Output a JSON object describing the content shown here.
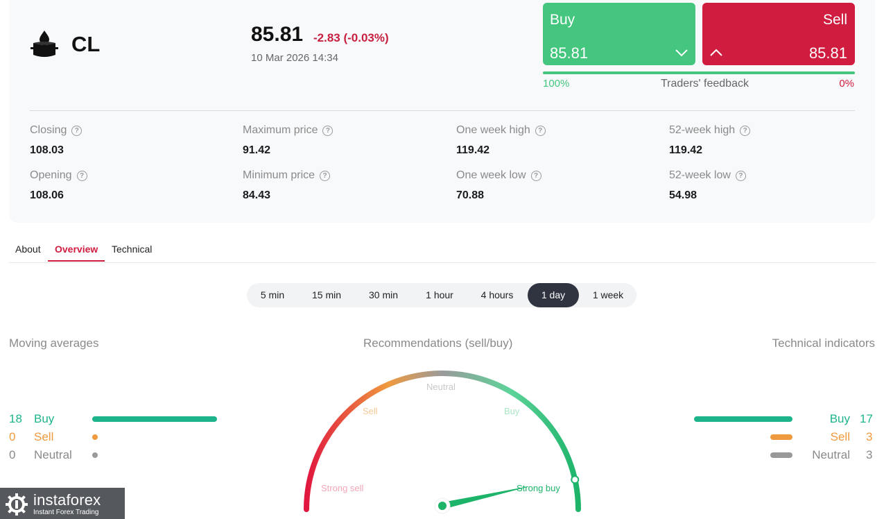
{
  "instrument": {
    "symbol": "CL",
    "icon": "oil-barrel-icon",
    "price": "85.81",
    "change": "-2.83 (-0.03%)",
    "datetime": "10 Mar 2026 14:34"
  },
  "trade": {
    "buy_label": "Buy",
    "buy_price": "85.81",
    "sell_label": "Sell",
    "sell_price": "85.81"
  },
  "feedback": {
    "buy_pct": "100%",
    "sell_pct": "0%",
    "label": "Traders' feedback",
    "buy_fraction": 1.0
  },
  "stats": [
    {
      "label": "Closing",
      "value": "108.03"
    },
    {
      "label": "Maximum price",
      "value": "91.42"
    },
    {
      "label": "One week high",
      "value": "119.42"
    },
    {
      "label": "52-week high",
      "value": "119.42"
    },
    {
      "label": "Opening",
      "value": "108.06"
    },
    {
      "label": "Minimum price",
      "value": "84.43"
    },
    {
      "label": "One week low",
      "value": "70.88"
    },
    {
      "label": "52-week low",
      "value": "54.98"
    }
  ],
  "tabs": [
    {
      "label": "About",
      "active": false
    },
    {
      "label": "Overview",
      "active": true
    },
    {
      "label": "Technical",
      "active": false
    }
  ],
  "periods": [
    {
      "label": "5 min",
      "active": false
    },
    {
      "label": "15 min",
      "active": false
    },
    {
      "label": "30 min",
      "active": false
    },
    {
      "label": "1 hour",
      "active": false
    },
    {
      "label": "4 hours",
      "active": false
    },
    {
      "label": "1 day",
      "active": true
    },
    {
      "label": "1 week",
      "active": false
    }
  ],
  "moving_averages": {
    "title": "Moving averages",
    "rows": [
      {
        "count": "18",
        "label": "Buy"
      },
      {
        "count": "0",
        "label": "Sell"
      },
      {
        "count": "0",
        "label": "Neutral"
      }
    ]
  },
  "technical_indicators": {
    "title": "Technical indicators",
    "rows": [
      {
        "count": "17",
        "label": "Buy"
      },
      {
        "count": "3",
        "label": "Sell"
      },
      {
        "count": "3",
        "label": "Neutral"
      }
    ]
  },
  "gauge": {
    "title": "Recommendations (sell/buy)",
    "labels": {
      "strong_sell": "Strong sell",
      "sell": "Sell",
      "neutral": "Neutral",
      "buy": "Buy",
      "strong_buy": "Strong buy"
    },
    "value": 0.93
  },
  "colors": {
    "buy": "#45c67e",
    "sell": "#cf1c3f",
    "teal": "#1db48c",
    "orange": "#ef9a3e",
    "gray": "#999999"
  },
  "logo": {
    "name": "instaforex",
    "tagline": "Instant Forex Trading"
  }
}
